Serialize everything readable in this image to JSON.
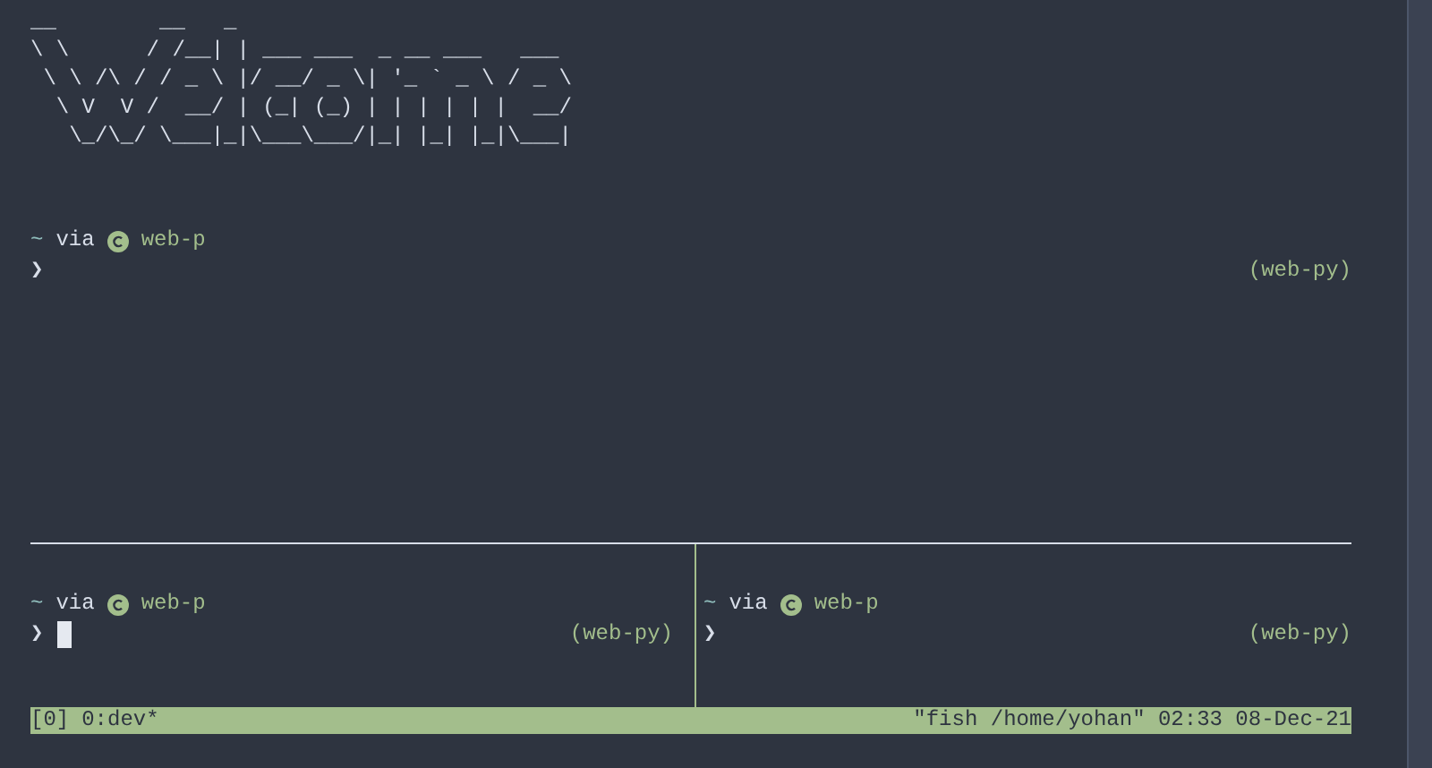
{
  "banner": {
    "lines": [
      "__        __   _",
      "\\ \\      / /__| | ___ ___  _ __ ___   ___",
      " \\ \\ /\\ / / _ \\ |/ __/ _ \\| '_ ` _ \\ / _ \\",
      "  \\ V  V /  __/ | (_| (_) | | | | | |  __/",
      "   \\_/\\_/ \\___|_|\\___\\___/|_| |_| |_|\\___|"
    ]
  },
  "panes": [
    {
      "dir": "~",
      "via": "via",
      "env": "web-p",
      "symbol": "❯",
      "right": "(web-py)",
      "cursor": false
    },
    {
      "dir": "~",
      "via": "via",
      "env": "web-p",
      "symbol": "❯",
      "right": "(web-py)",
      "cursor": true
    },
    {
      "dir": "~",
      "via": "via",
      "env": "web-p",
      "symbol": "❯",
      "right": "(web-py)",
      "cursor": false
    }
  ],
  "status_bar": {
    "session": "[0]",
    "window": "0:dev*",
    "right": "\"fish /home/yohan\" 02:33 08-Dec-21"
  }
}
